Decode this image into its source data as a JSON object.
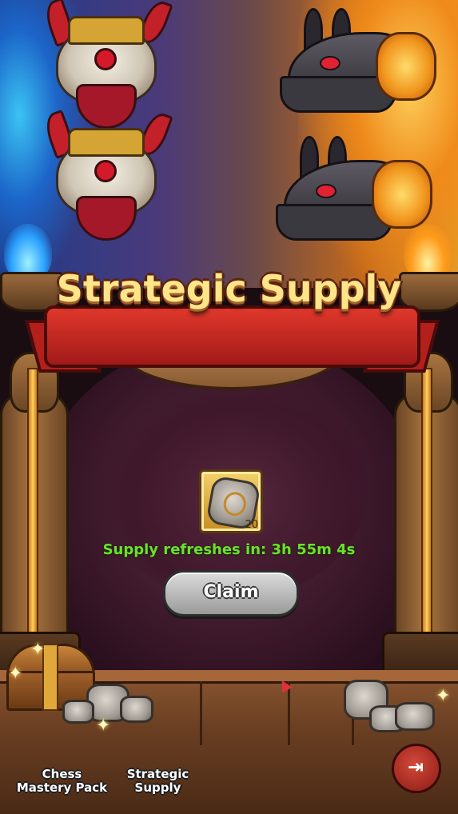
{
  "title": "Strategic Supply",
  "reward": {
    "icon": "stone-coin-icon",
    "quantity": "20"
  },
  "refresh_text": "Supply refreshes in: 3h 55m 4s",
  "claim_label": "Claim",
  "nav": {
    "chess_mastery_pack": "Chess Mastery Pack",
    "strategic_supply": "Strategic Supply"
  },
  "colors": {
    "title": "#ffe58a",
    "refresh": "#6ae22a",
    "ribbon": "#d0302a",
    "button": "#bdbdbd"
  }
}
